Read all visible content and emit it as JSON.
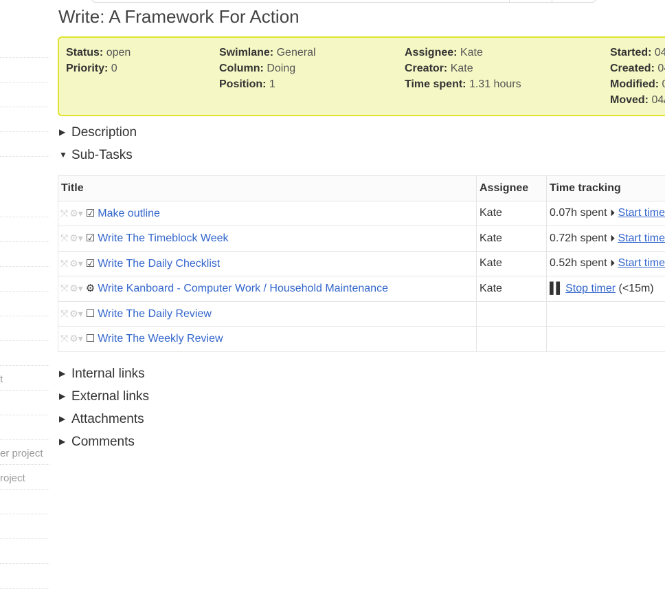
{
  "sidebar": {
    "items": [
      "",
      "",
      "",
      "",
      "",
      "",
      "",
      "",
      "",
      "",
      "",
      "t",
      "",
      "",
      "er project",
      "roject",
      "",
      "",
      "",
      ""
    ]
  },
  "title": "Write: A Framework For Action",
  "summary": {
    "col1": [
      {
        "k": "Status:",
        "v": "open"
      },
      {
        "k": "Priority:",
        "v": "0"
      }
    ],
    "col2": [
      {
        "k": "Swimlane:",
        "v": "General"
      },
      {
        "k": "Column:",
        "v": "Doing"
      },
      {
        "k": "Position:",
        "v": "1"
      }
    ],
    "col3": [
      {
        "k": "Assignee:",
        "v": "Kate"
      },
      {
        "k": "Creator:",
        "v": "Kate"
      },
      {
        "k": "Time spent:",
        "v": "1.31 hours"
      }
    ],
    "col4": [
      {
        "k": "Started:",
        "v": "04"
      },
      {
        "k": "Created:",
        "v": "04"
      },
      {
        "k": "Modified:",
        "v": "0"
      },
      {
        "k": "Moved:",
        "v": "04/"
      }
    ]
  },
  "sections": {
    "description": "Description",
    "subtasks": "Sub-Tasks",
    "internal": "Internal links",
    "external": "External links",
    "attachments": "Attachments",
    "comments": "Comments"
  },
  "table": {
    "headers": [
      "Title",
      "Assignee",
      "Time tracking"
    ],
    "rows": [
      {
        "status": "done",
        "title": "Make outline",
        "assignee": "Kate",
        "spent": "0.07h spent",
        "action": "Start timer"
      },
      {
        "status": "done",
        "title": "Write The Timeblock Week",
        "assignee": "Kate",
        "spent": "0.72h spent",
        "action": "Start timer"
      },
      {
        "status": "done",
        "title": "Write The Daily Checklist",
        "assignee": "Kate",
        "spent": "0.52h spent",
        "action": "Start timer"
      },
      {
        "status": "in-progress",
        "title": "Write Kanboard - Computer Work / Household Maintenance",
        "assignee": "Kate",
        "spent": "",
        "action": "Stop timer",
        "extra": "(<15m)"
      },
      {
        "status": "todo",
        "title": "Write The Daily Review",
        "assignee": "",
        "spent": "",
        "action": ""
      },
      {
        "status": "todo",
        "title": "Write The Weekly Review",
        "assignee": "",
        "spent": "",
        "action": ""
      }
    ]
  },
  "colors": {
    "link": "#3366cc",
    "summary_bg": "#f5f7c4",
    "summary_border": "#dfe32d"
  }
}
